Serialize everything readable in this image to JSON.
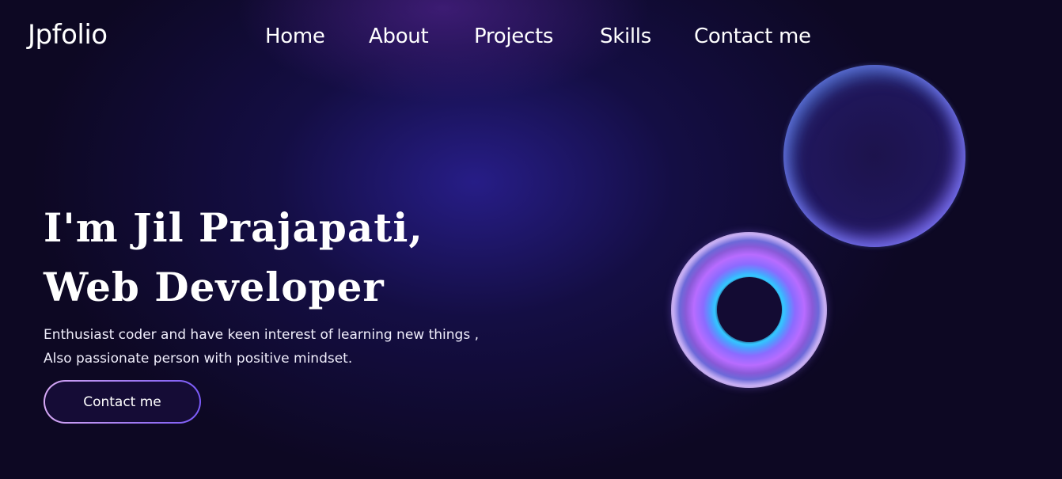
{
  "brand": {
    "logo_text": "Jpfolio"
  },
  "nav": {
    "items": [
      {
        "label": "Home"
      },
      {
        "label": "About"
      },
      {
        "label": "Projects"
      },
      {
        "label": "Skills"
      },
      {
        "label": "Contact me"
      }
    ]
  },
  "hero": {
    "title_line1": "I'm Jil Prajapati,",
    "title_line2": "Web Developer",
    "description_line1": "Enthusiast coder and have keen interest of learning new things ,",
    "description_line2": "Also passionate person with positive mindset.",
    "cta_label": "Contact me"
  },
  "colors": {
    "background": "#0d0823",
    "glow": "#2a1f8c",
    "button_border_start": "#d6a8f5",
    "button_border_end": "#7a5af8",
    "text": "#ffffff"
  }
}
